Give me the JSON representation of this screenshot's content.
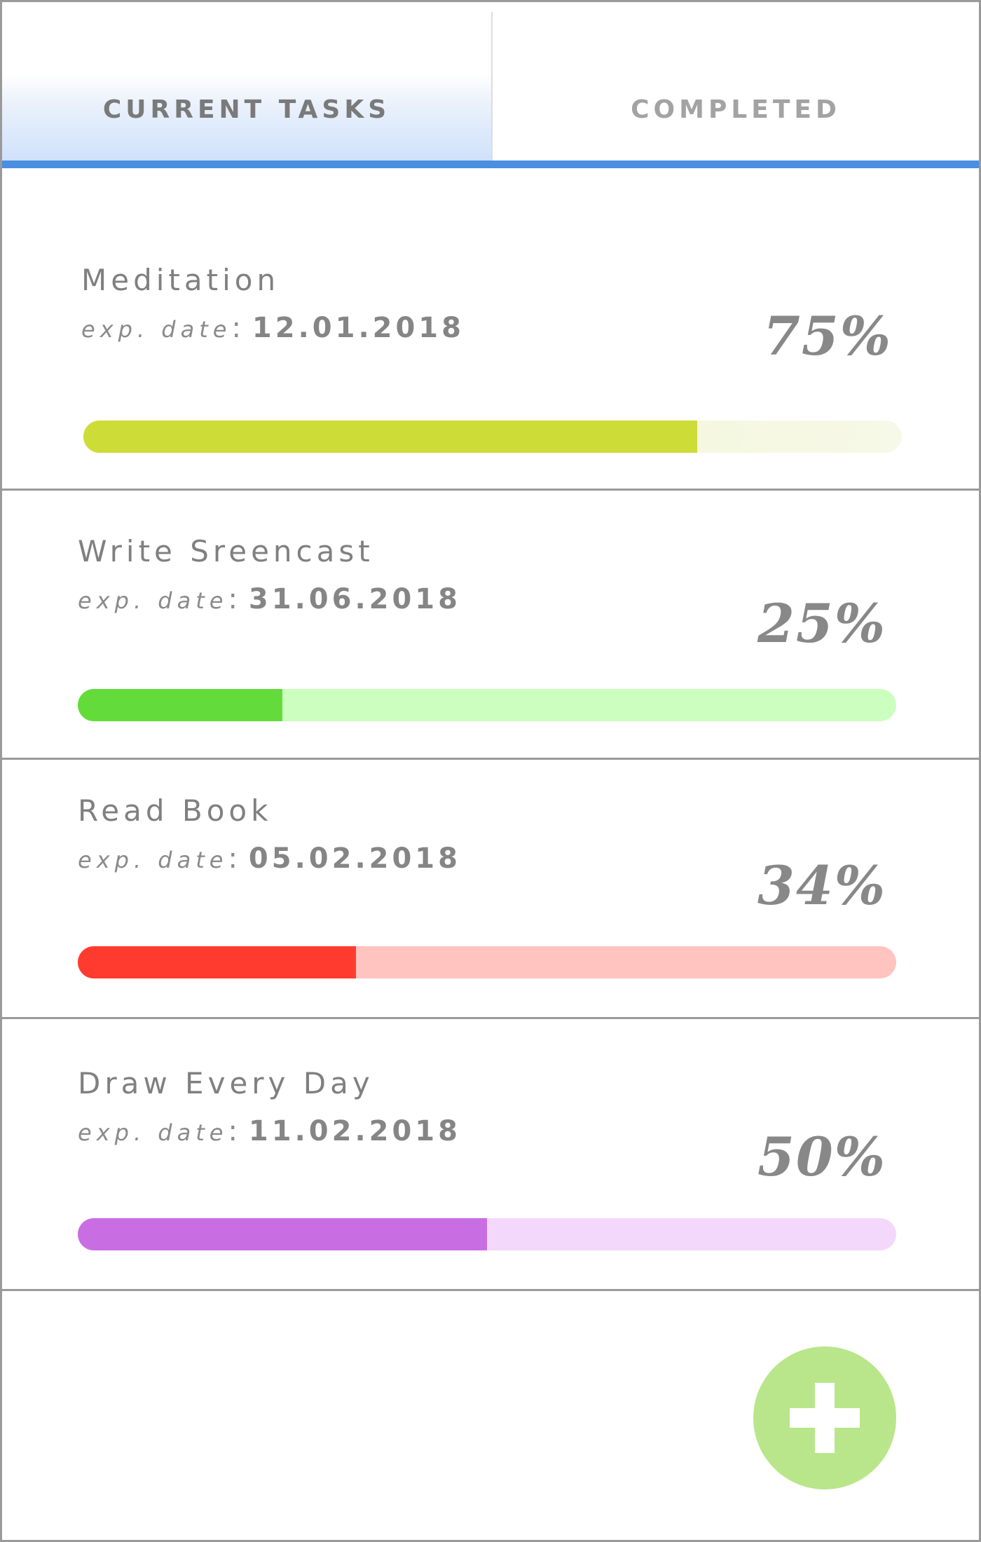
{
  "tabs": [
    {
      "label": "CURRENT TASKS",
      "active": true
    },
    {
      "label": "COMPLETED",
      "active": false
    }
  ],
  "date_label": "exp. date",
  "tasks": [
    {
      "name": "Meditation",
      "date": "12.01.2018",
      "percent_label": "75%",
      "progress": 0.75,
      "fill_color": "#cddc37",
      "track_color": "#eef2c6",
      "track_fade": true
    },
    {
      "name": "Write Sreencast",
      "date": "31.06.2018",
      "percent_label": "25%",
      "progress": 0.25,
      "fill_color": "#63dc3b",
      "track_color": "#ccffbf",
      "track_fade": false
    },
    {
      "name": "Read Book",
      "date": "05.02.2018",
      "percent_label": "34%",
      "progress": 0.34,
      "fill_color": "#ff3b30",
      "track_color": "#ffc4c0",
      "track_fade": false
    },
    {
      "name": "Draw Every Day",
      "date": "11.02.2018",
      "percent_label": "50%",
      "progress": 0.5,
      "fill_color": "#c96ee2",
      "track_color": "#f4d8fb",
      "track_fade": false
    }
  ],
  "accent_color": "#4a8fe0",
  "add_button": {
    "icon": "plus-icon",
    "color": "#b9e68a"
  }
}
